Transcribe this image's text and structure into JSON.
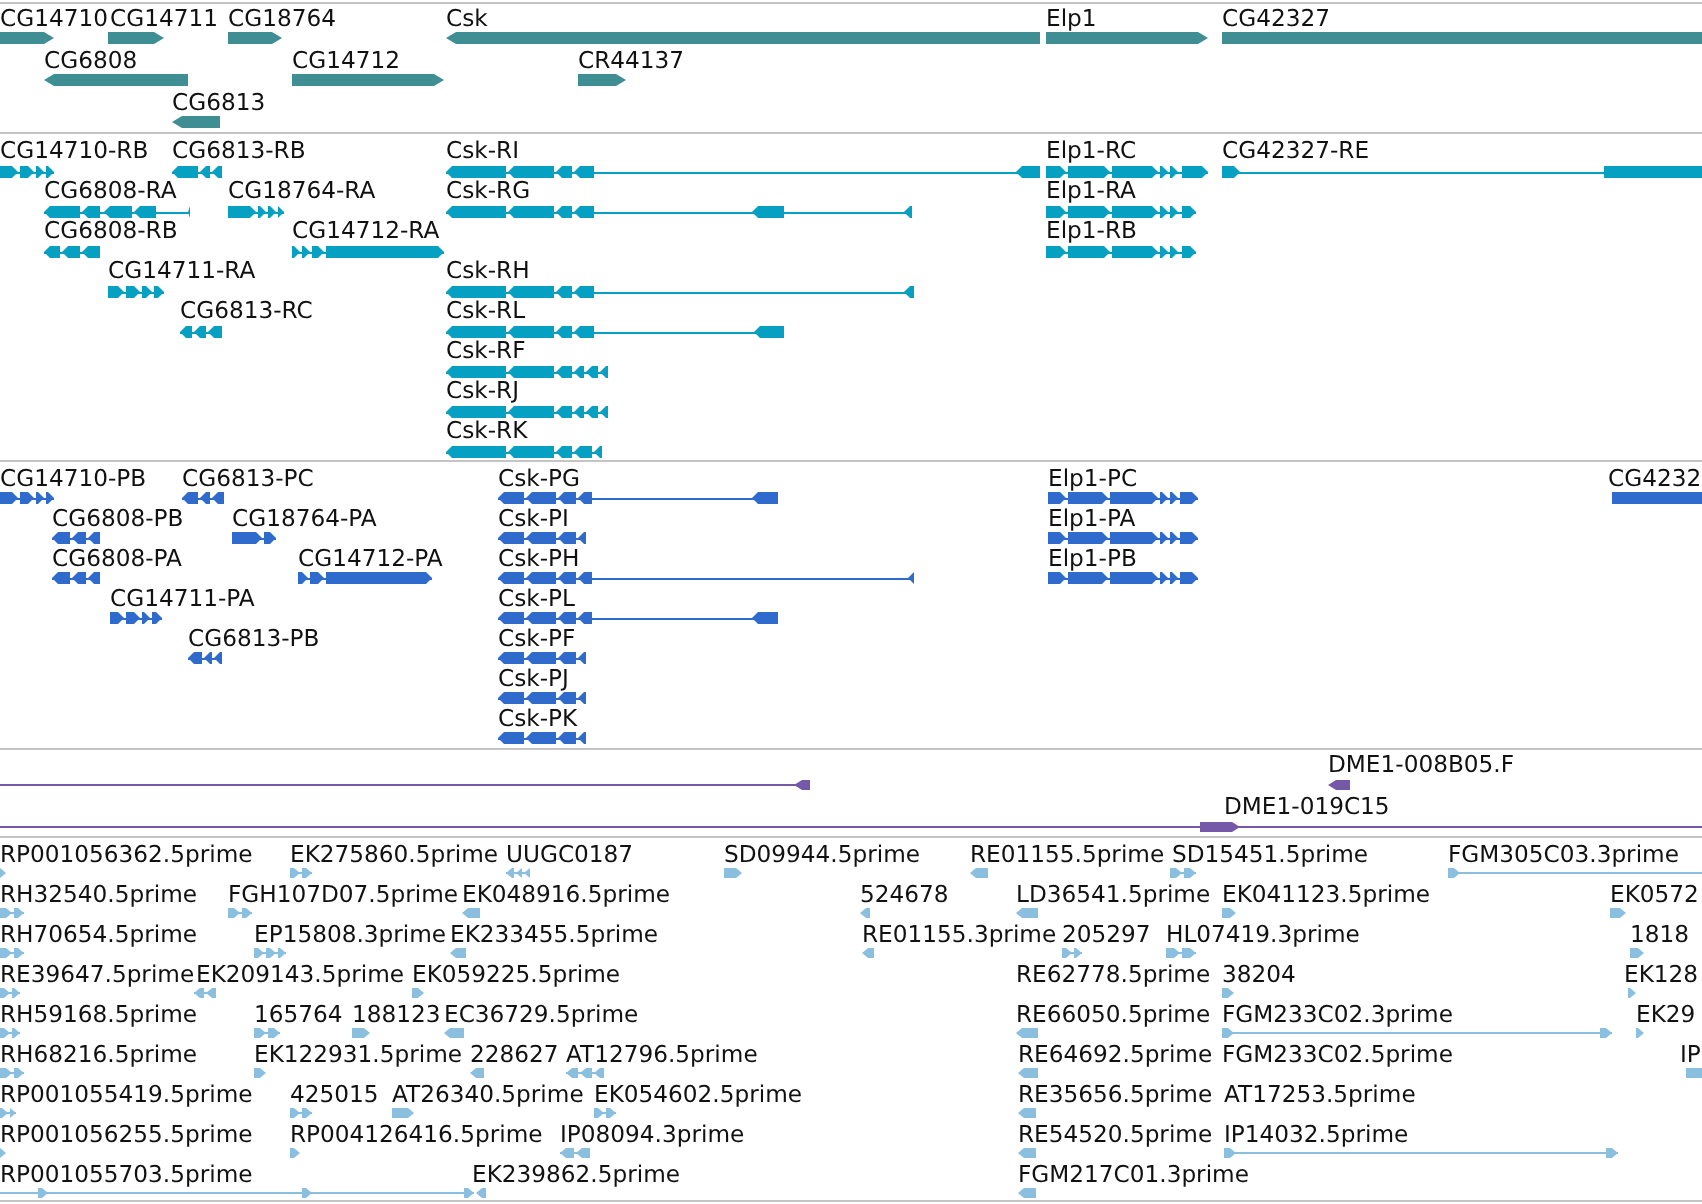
{
  "tracks": [
    {
      "kind": "gene",
      "color": "#3f8e94",
      "features": [
        {
          "label": "CG14710",
          "reverse": false
        },
        {
          "label": "CG14711",
          "reverse": false
        },
        {
          "label": "CG18764",
          "reverse": false
        },
        {
          "label": "Csk",
          "reverse": true
        },
        {
          "label": "Elp1",
          "reverse": false
        },
        {
          "label": "CG42327",
          "reverse": false
        },
        {
          "label": "CG6808",
          "reverse": true
        },
        {
          "label": "CG14712",
          "reverse": false
        },
        {
          "label": "CR44137",
          "reverse": false
        },
        {
          "label": "CG6813",
          "reverse": true
        }
      ]
    },
    {
      "kind": "transcript",
      "color": "#05a0c2",
      "features": [
        {
          "label": "CG14710-RB",
          "reverse": false
        },
        {
          "label": "CG6813-RB",
          "reverse": true
        },
        {
          "label": "Csk-RI",
          "reverse": true
        },
        {
          "label": "Elp1-RC",
          "reverse": false
        },
        {
          "label": "CG42327-RE",
          "reverse": false
        },
        {
          "label": "CG6808-RA",
          "reverse": true
        },
        {
          "label": "CG18764-RA",
          "reverse": false
        },
        {
          "label": "Csk-RG",
          "reverse": true
        },
        {
          "label": "Elp1-RA",
          "reverse": false
        },
        {
          "label": "CG6808-RB",
          "reverse": true
        },
        {
          "label": "CG14712-RA",
          "reverse": false
        },
        {
          "label": "Elp1-RB",
          "reverse": false
        },
        {
          "label": "CG14711-RA",
          "reverse": false
        },
        {
          "label": "Csk-RH",
          "reverse": true
        },
        {
          "label": "CG6813-RC",
          "reverse": true
        },
        {
          "label": "Csk-RL",
          "reverse": true
        },
        {
          "label": "Csk-RF",
          "reverse": true
        },
        {
          "label": "Csk-RJ",
          "reverse": true
        },
        {
          "label": "Csk-RK",
          "reverse": true
        }
      ]
    },
    {
      "kind": "protein",
      "color": "#2f6bcd",
      "features": [
        {
          "label": "CG14710-PB",
          "reverse": false
        },
        {
          "label": "CG6813-PC",
          "reverse": true
        },
        {
          "label": "Csk-PG",
          "reverse": true
        },
        {
          "label": "Elp1-PC",
          "reverse": false
        },
        {
          "label": "CG4232",
          "reverse": false
        },
        {
          "label": "CG6808-PB",
          "reverse": true
        },
        {
          "label": "CG18764-PA",
          "reverse": false
        },
        {
          "label": "Csk-PI",
          "reverse": true
        },
        {
          "label": "Elp1-PA",
          "reverse": false
        },
        {
          "label": "CG6808-PA",
          "reverse": true
        },
        {
          "label": "CG14712-PA",
          "reverse": false
        },
        {
          "label": "Csk-PH",
          "reverse": true
        },
        {
          "label": "Elp1-PB",
          "reverse": false
        },
        {
          "label": "CG14711-PA",
          "reverse": false
        },
        {
          "label": "Csk-PL",
          "reverse": true
        },
        {
          "label": "CG6813-PB",
          "reverse": true
        },
        {
          "label": "Csk-PF",
          "reverse": true
        },
        {
          "label": "Csk-PJ",
          "reverse": true
        },
        {
          "label": "Csk-PK",
          "reverse": true
        }
      ]
    },
    {
      "kind": "clone",
      "color": "#7658a8",
      "features": [
        {
          "reverse": true
        },
        {
          "label": "DME1-008B05.F",
          "reverse": true
        },
        {
          "label": "DME1-019C15",
          "reverse": false
        }
      ]
    },
    {
      "kind": "est",
      "color": "#8abfe0",
      "features": [
        {
          "label": "RP001056362.5prime",
          "reverse": false
        },
        {
          "label": "EK275860.5prime",
          "reverse": false
        },
        {
          "label": "UUGC0187",
          "reverse": true
        },
        {
          "label": "SD09944.5prime",
          "reverse": false
        },
        {
          "label": "RE01155.5prime",
          "reverse": true
        },
        {
          "label": "SD15451.5prime",
          "reverse": false
        },
        {
          "label": "FGM305C03.3prime",
          "reverse": false
        },
        {
          "label": "RH32540.5prime",
          "reverse": false
        },
        {
          "label": "FGH107D07.5prime",
          "reverse": false
        },
        {
          "label": "EK048916.5prime",
          "reverse": true
        },
        {
          "label": "524678",
          "reverse": true
        },
        {
          "label": "LD36541.5prime",
          "reverse": true
        },
        {
          "label": "EK041123.5prime",
          "reverse": false
        },
        {
          "label": "EK0572",
          "reverse": false
        },
        {
          "label": "RH70654.5prime",
          "reverse": false
        },
        {
          "label": "EP15808.3prime",
          "reverse": false
        },
        {
          "label": "EK233455.5prime",
          "reverse": true
        },
        {
          "label": "RE01155.3prime",
          "reverse": true
        },
        {
          "label": "205297",
          "reverse": false
        },
        {
          "label": "HL07419.3prime",
          "reverse": false
        },
        {
          "label": "1818",
          "reverse": false
        },
        {
          "label": "RE39647.5prime",
          "reverse": false
        },
        {
          "label": "EK209143.5prime",
          "reverse": true
        },
        {
          "label": "EK059225.5prime",
          "reverse": false
        },
        {
          "label": "RE62778.5prime"
        },
        {
          "label": "38204",
          "reverse": false
        },
        {
          "label": "EK128",
          "reverse": false
        },
        {
          "label": "RH59168.5prime",
          "reverse": false
        },
        {
          "label": "165764",
          "reverse": false
        },
        {
          "label": "188123",
          "reverse": false
        },
        {
          "label": "EC36729.5prime",
          "reverse": true
        },
        {
          "label": "RE66050.5prime",
          "reverse": true
        },
        {
          "label": "FGM233C02.3prime",
          "reverse": false
        },
        {
          "label": "EK29",
          "reverse": false
        },
        {
          "label": "RH68216.5prime",
          "reverse": false
        },
        {
          "label": "EK122931.5prime",
          "reverse": false
        },
        {
          "label": "228627",
          "reverse": true
        },
        {
          "label": "AT12796.5prime",
          "reverse": true
        },
        {
          "label": "RE64692.5prime",
          "reverse": true
        },
        {
          "label": "FGM233C02.5prime"
        },
        {
          "label": "IP",
          "reverse": false
        },
        {
          "label": "RP001055419.5prime",
          "reverse": false
        },
        {
          "label": "425015",
          "reverse": false
        },
        {
          "label": "AT26340.5prime",
          "reverse": false
        },
        {
          "label": "EK054602.5prime",
          "reverse": false
        },
        {
          "label": "RE35656.5prime",
          "reverse": true
        },
        {
          "label": "AT17253.5prime"
        },
        {
          "label": "RP001056255.5prime",
          "reverse": false
        },
        {
          "label": "RP004126416.5prime",
          "reverse": false
        },
        {
          "label": "IP08094.3prime",
          "reverse": true
        },
        {
          "label": "RE54520.5prime",
          "reverse": true
        },
        {
          "label": "IP14032.5prime",
          "reverse": false
        },
        {
          "label": "RP001055703.5prime",
          "reverse": false
        },
        {
          "label": "EK239862.5prime",
          "reverse": true
        },
        {
          "label": "FGM217C01.3prime",
          "reverse": true
        }
      ]
    }
  ]
}
